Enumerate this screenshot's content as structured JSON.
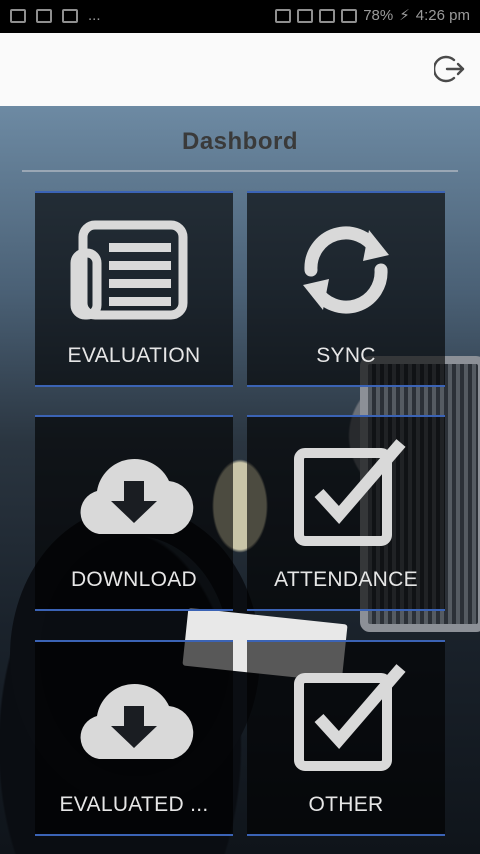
{
  "status_bar": {
    "left_text": "...",
    "battery": "78%",
    "time": "4:26 pm"
  },
  "app_bar": {
    "logout_icon": "logout-icon"
  },
  "page": {
    "title": "Dashbord"
  },
  "tiles": [
    {
      "label": "EVALUATION",
      "icon": "newspaper-icon"
    },
    {
      "label": "SYNC",
      "icon": "sync-icon"
    },
    {
      "label": "DOWNLOAD",
      "icon": "cloud-download-icon"
    },
    {
      "label": "ATTENDANCE",
      "icon": "checkbox-icon"
    },
    {
      "label": "EVALUATED ...",
      "icon": "cloud-download-icon"
    },
    {
      "label": "OTHER",
      "icon": "checkbox-icon"
    }
  ],
  "colors": {
    "tile_border": "#3b63b5",
    "icon_color": "#d9d9d9"
  }
}
